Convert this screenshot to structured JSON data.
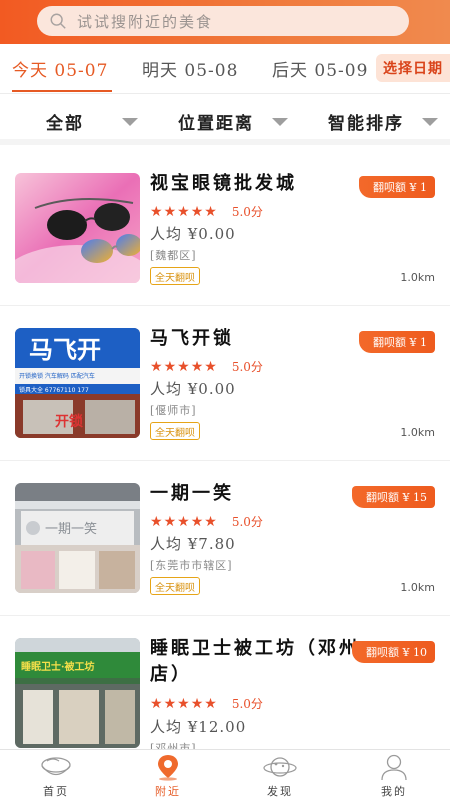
{
  "search": {
    "placeholder": "试试搜附近的美食"
  },
  "date_tabs": [
    {
      "label": "今天 05-07",
      "active": true
    },
    {
      "label": "明天 05-08",
      "active": false
    },
    {
      "label": "后天 05-09",
      "active": false
    }
  ],
  "pick_date_label": "选择日期",
  "filters": [
    {
      "label": "全部"
    },
    {
      "label": "位置距离"
    },
    {
      "label": "智能排序"
    }
  ],
  "items": [
    {
      "name": "视宝眼镜批发城",
      "badge": "翻呗额 ¥ 1",
      "rating": 5,
      "score": "5.0分",
      "avg": "人均 ¥0.00",
      "area": "[魏都区]",
      "tag": "全天翻呗",
      "distance": "1.0km",
      "image": "sunglasses-photo"
    },
    {
      "name": "马飞开锁",
      "badge": "翻呗额 ¥ 1",
      "rating": 5,
      "score": "5.0分",
      "avg": "人均 ¥0.00",
      "area": "[偃师市]",
      "tag": "全天翻呗",
      "distance": "1.0km",
      "image": "lock-shop-photo"
    },
    {
      "name": "一期一笑",
      "badge": "翻呗额 ¥ 15",
      "rating": 5,
      "score": "5.0分",
      "avg": "人均 ¥7.80",
      "area": "[东莞市市辖区]",
      "tag": "全天翻呗",
      "distance": "1.0km",
      "image": "storefront-photo"
    },
    {
      "name": "睡眠卫士被工坊（邓州店）",
      "badge": "翻呗额 ¥ 10",
      "rating": 5,
      "score": "5.0分",
      "avg": "人均 ¥12.00",
      "area": "[邓州市]",
      "tag": "",
      "distance": "",
      "image": "bedding-shop-photo"
    }
  ],
  "thumb_texts": {
    "lock_sign": "马飞开",
    "lock_sub": "开锁换锁  汽车解码  匹配汽车",
    "lock_phone": "锁具大全  67767110  177",
    "lock_lower": "开锁",
    "store_sign": "一期一笑",
    "bed_sign": "睡眠卫士·被工坊"
  },
  "nav": [
    {
      "label": "首页",
      "icon": "bowl-icon",
      "active": false
    },
    {
      "label": "附近",
      "icon": "location-pin-icon",
      "active": true
    },
    {
      "label": "发现",
      "icon": "planet-icon",
      "active": false
    },
    {
      "label": "我的",
      "icon": "user-icon",
      "active": false
    }
  ],
  "colors": {
    "accent": "#e65a24",
    "star": "#e8502b",
    "tag": "#e6a417"
  }
}
